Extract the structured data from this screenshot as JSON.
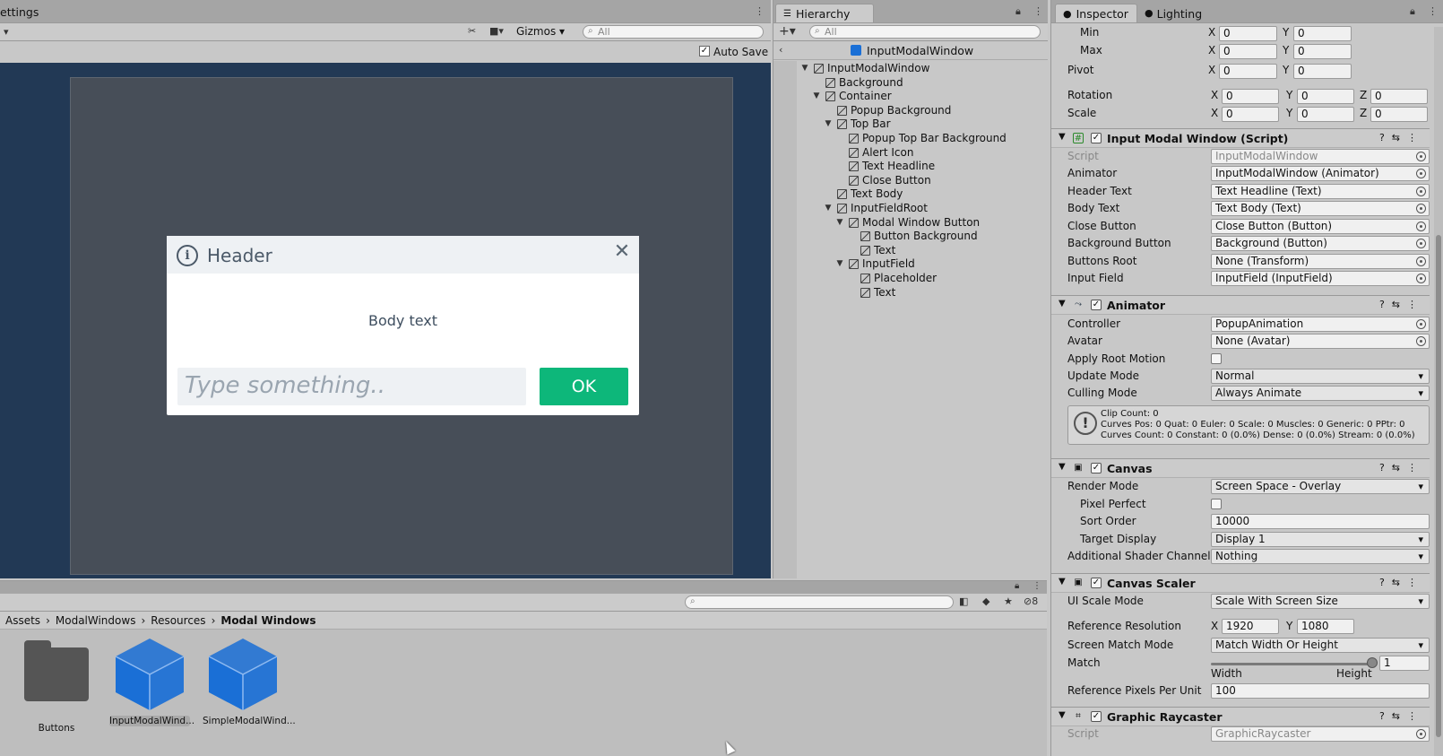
{
  "scene": {
    "tab_label": "ettings",
    "gizmos_label": "Gizmos",
    "search_placeholder": "All",
    "auto_save_label": "Auto Save",
    "auto_save_checked": true
  },
  "modal": {
    "header": "Header",
    "alert_glyph": "i",
    "close_glyph": "✕",
    "body": "Body text",
    "placeholder": "Type something..",
    "ok_label": "OK"
  },
  "hierarchy": {
    "tab_label": "Hierarchy",
    "search_placeholder": "All",
    "scene_name": "InputModalWindow",
    "items": [
      {
        "label": "InputModalWindow",
        "depth": 0,
        "expanded": true
      },
      {
        "label": "Background",
        "depth": 1
      },
      {
        "label": "Container",
        "depth": 1,
        "expanded": true
      },
      {
        "label": "Popup Background",
        "depth": 2
      },
      {
        "label": "Top Bar",
        "depth": 2,
        "expanded": true
      },
      {
        "label": "Popup Top Bar Background",
        "depth": 3
      },
      {
        "label": "Alert Icon",
        "depth": 3
      },
      {
        "label": "Text Headline",
        "depth": 3
      },
      {
        "label": "Close Button",
        "depth": 3
      },
      {
        "label": "Text Body",
        "depth": 2
      },
      {
        "label": "InputFieldRoot",
        "depth": 2,
        "expanded": true
      },
      {
        "label": "Modal Window Button",
        "depth": 3,
        "expanded": true
      },
      {
        "label": "Button Background",
        "depth": 4
      },
      {
        "label": "Text",
        "depth": 4
      },
      {
        "label": "InputField",
        "depth": 3,
        "expanded": true
      },
      {
        "label": "Placeholder",
        "depth": 4
      },
      {
        "label": "Text",
        "depth": 4
      }
    ]
  },
  "project": {
    "breadcrumb": [
      "Assets",
      "ModalWindows",
      "Resources",
      "Modal Windows"
    ],
    "hidden_count": "8",
    "assets": [
      {
        "label": "Buttons",
        "kind": "folder"
      },
      {
        "label": "InputModalWind...",
        "kind": "prefab",
        "selected": true
      },
      {
        "label": "SimpleModalWind...",
        "kind": "prefab"
      }
    ],
    "prefab_color": "#1a6fd6"
  },
  "inspector": {
    "tab_inspector": "Inspector",
    "tab_lighting": "Lighting",
    "transform": {
      "min_label": "Min",
      "min_x": "0",
      "min_y": "0",
      "max_label": "Max",
      "max_x": "0",
      "max_y": "0",
      "pivot_label": "Pivot",
      "pivot_x": "0",
      "pivot_y": "0",
      "rotation_label": "Rotation",
      "rot_x": "0",
      "rot_y": "0",
      "rot_z": "0",
      "scale_label": "Scale",
      "scale_x": "0",
      "scale_y": "0",
      "scale_z": "0"
    },
    "script_comp": {
      "title": "Input Modal Window (Script)",
      "rows": [
        {
          "label": "Script",
          "value": "InputModalWindow",
          "disabled": true
        },
        {
          "label": "Animator",
          "value": "InputModalWindow (Animator)"
        },
        {
          "label": "Header Text",
          "value": "Text Headline (Text)"
        },
        {
          "label": "Body Text",
          "value": "Text Body (Text)"
        },
        {
          "label": "Close Button",
          "value": "Close Button (Button)"
        },
        {
          "label": "Background Button",
          "value": "Background (Button)"
        },
        {
          "label": "Buttons Root",
          "value": "None (Transform)"
        },
        {
          "label": "Input Field",
          "value": "InputField (InputField)"
        }
      ]
    },
    "animator": {
      "title": "Animator",
      "controller_label": "Controller",
      "controller_value": "PopupAnimation",
      "avatar_label": "Avatar",
      "avatar_value": "None (Avatar)",
      "root_motion_label": "Apply Root Motion",
      "update_mode_label": "Update Mode",
      "update_mode_value": "Normal",
      "culling_label": "Culling Mode",
      "culling_value": "Always Animate",
      "info_line1": "Clip Count: 0",
      "info_line2": "Curves Pos: 0 Quat: 0 Euler: 0 Scale: 0 Muscles: 0 Generic: 0 PPtr: 0",
      "info_line3": "Curves Count: 0 Constant: 0 (0.0%) Dense: 0 (0.0%) Stream: 0 (0.0%)"
    },
    "canvas": {
      "title": "Canvas",
      "render_mode_label": "Render Mode",
      "render_mode_value": "Screen Space - Overlay",
      "pixel_perfect_label": "Pixel Perfect",
      "sort_order_label": "Sort Order",
      "sort_order_value": "10000",
      "target_display_label": "Target Display",
      "target_display_value": "Display 1",
      "shader_channels_label": "Additional Shader Channels",
      "shader_channels_value": "Nothing"
    },
    "canvas_scaler": {
      "title": "Canvas Scaler",
      "ui_scale_label": "UI Scale Mode",
      "ui_scale_value": "Scale With Screen Size",
      "ref_res_label": "Reference Resolution",
      "ref_x": "1920",
      "ref_y": "1080",
      "match_mode_label": "Screen Match Mode",
      "match_mode_value": "Match Width Or Height",
      "match_label": "Match",
      "match_value": "1",
      "match_fraction": 1,
      "width_label": "Width",
      "height_label": "Height",
      "ppu_label": "Reference Pixels Per Unit",
      "ppu_value": "100"
    },
    "raycaster": {
      "title": "Graphic Raycaster",
      "script_label": "Script",
      "script_value": "GraphicRaycaster"
    }
  }
}
